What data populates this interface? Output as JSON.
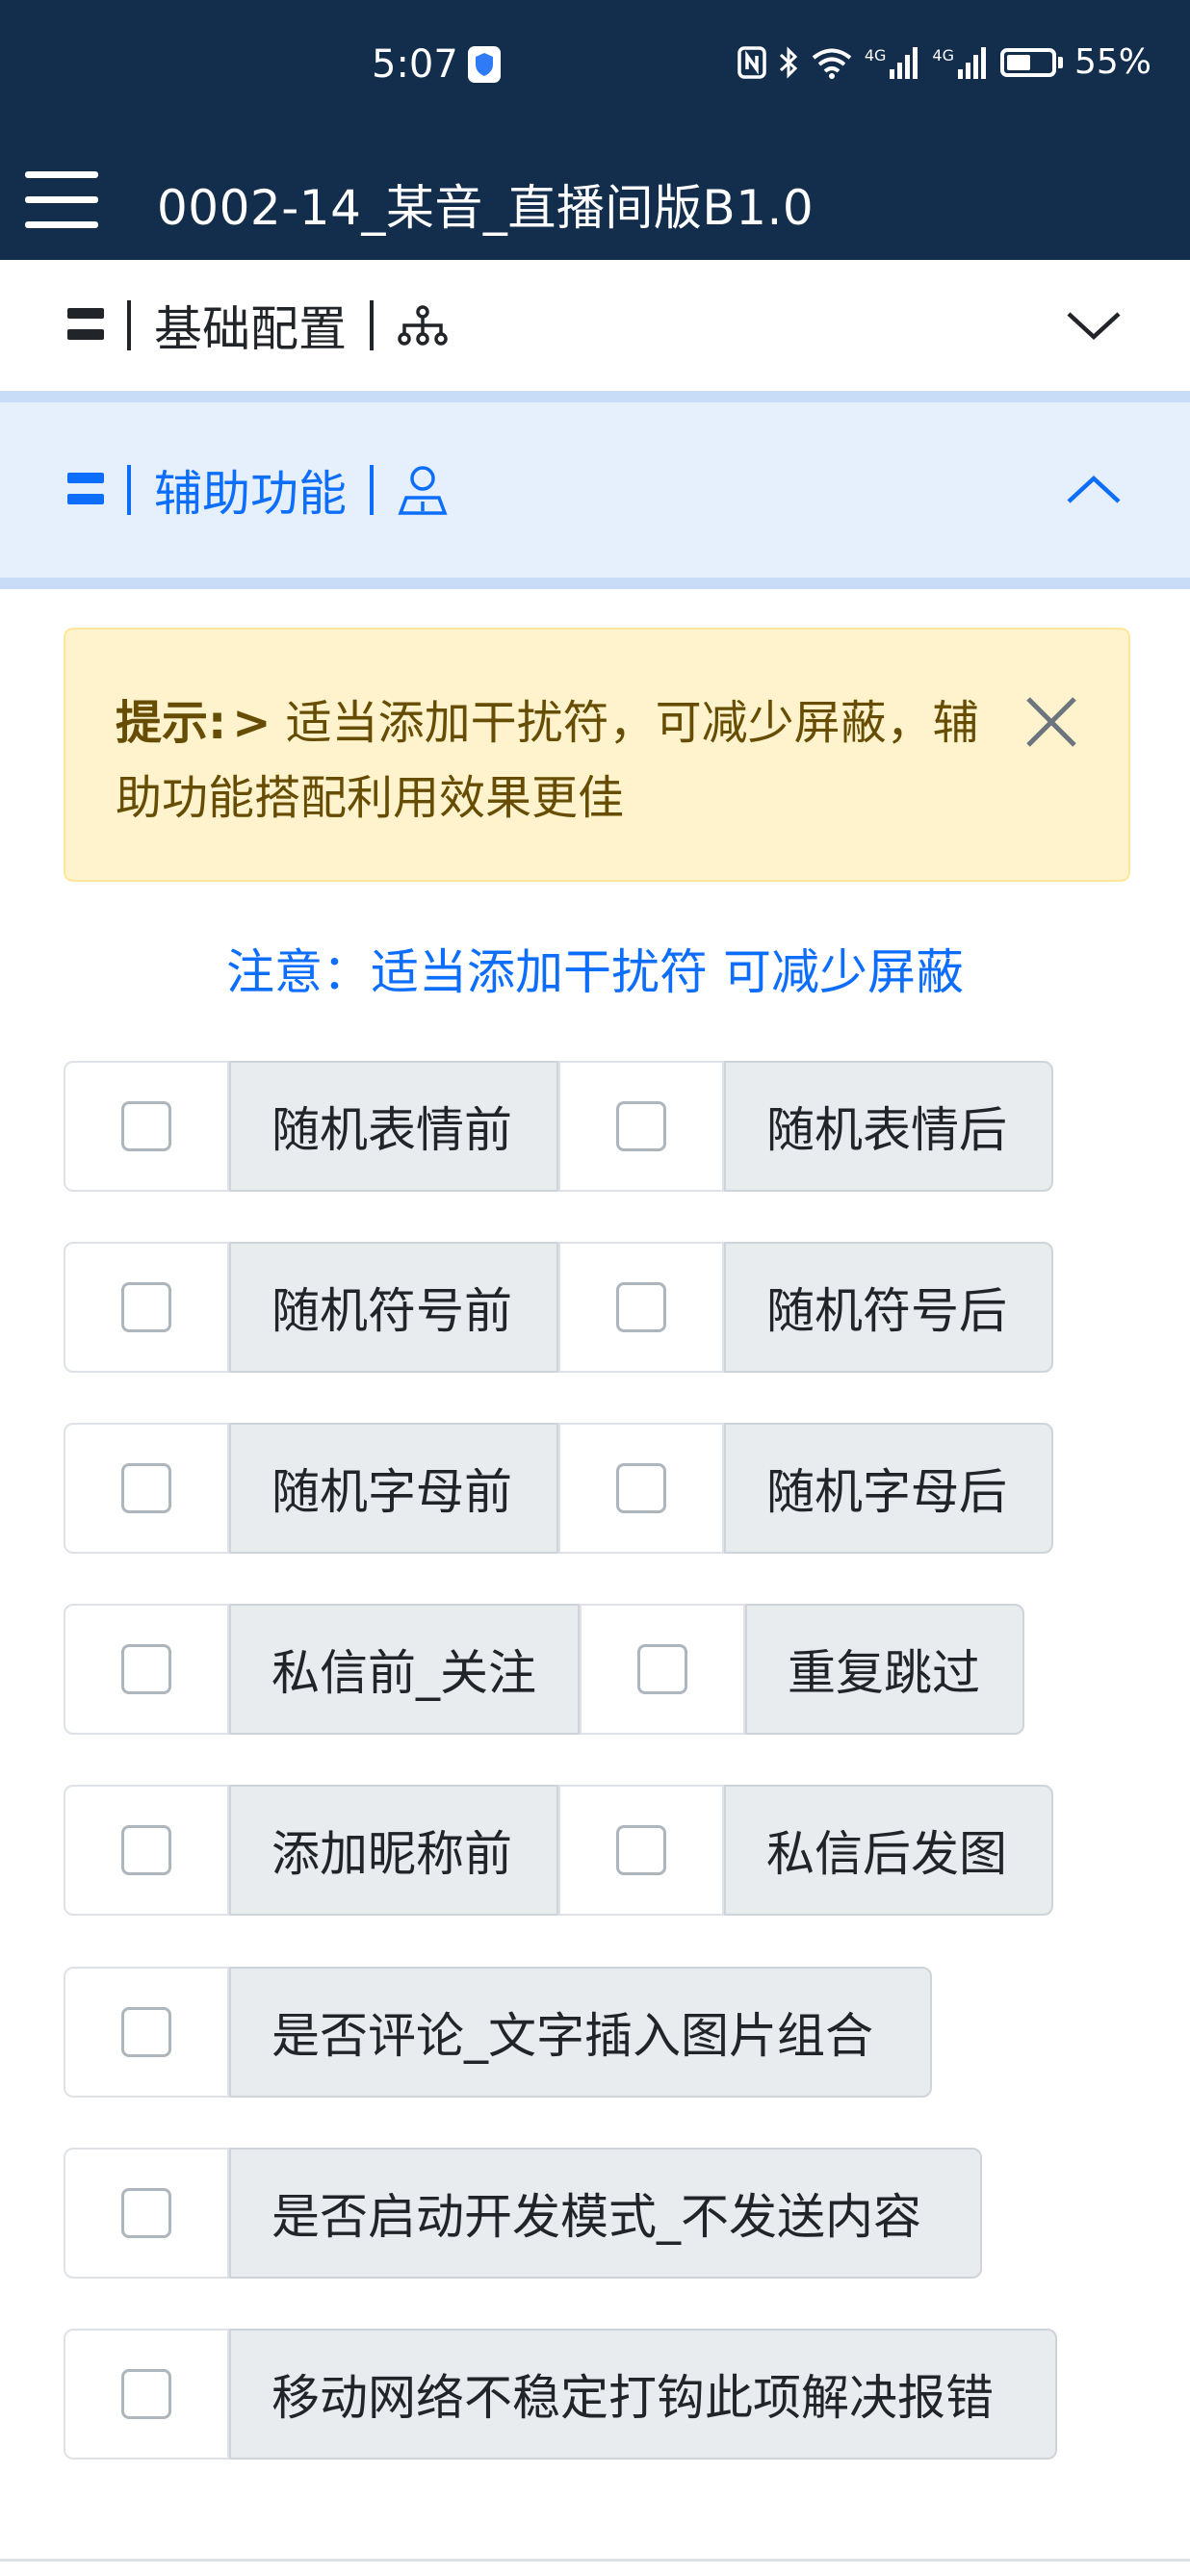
{
  "status_bar": {
    "time": "5:07",
    "network_label_1": "4G",
    "network_label_2": "4G",
    "battery": "55%",
    "battery_level": 0.55
  },
  "app_bar": {
    "title": "0002-14_某音_直播间版B1.0"
  },
  "sections": [
    {
      "title": "基础配置",
      "expanded": false,
      "icon": "sitemap-icon"
    },
    {
      "title": "辅助功能",
      "expanded": true,
      "icon": "user-icon"
    }
  ],
  "alert": {
    "label": "提示:",
    "arrow": ">",
    "text": " 适当添加干扰符，可减少屏蔽，辅助功能搭配利用效果更佳"
  },
  "note": "注意：适当添加干扰符 可减少屏蔽",
  "options": [
    [
      "随机表情前",
      "随机表情后"
    ],
    [
      "随机符号前",
      "随机符号后"
    ],
    [
      "随机字母前",
      "随机字母后"
    ],
    [
      "私信前_关注",
      "重复跳过"
    ],
    [
      "添加昵称前",
      "私信后发图"
    ],
    [
      "是否评论_文字插入图片组合"
    ],
    [
      "是否启动开发模式_不发送内容"
    ],
    [
      "移动网络不稳定打钩此项解决报错"
    ]
  ],
  "colors": {
    "header_bg": "#132d4c",
    "accent": "#0d6efd",
    "alert_bg": "#fff3cd",
    "alert_text": "#664d03"
  }
}
